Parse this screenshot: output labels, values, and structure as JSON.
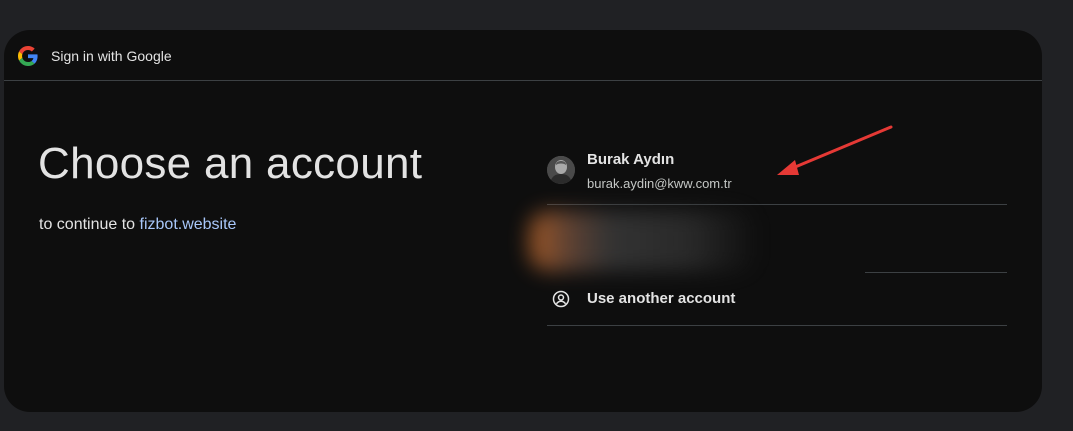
{
  "header": {
    "title": "Sign in with Google"
  },
  "main": {
    "title": "Choose an account",
    "subtitle_prefix": "to continue to ",
    "subtitle_link": "fizbot.website"
  },
  "accounts": [
    {
      "name": "Burak Aydın",
      "email": "burak.aydin@kww.com.tr",
      "icon": "user-avatar"
    }
  ],
  "use_another": {
    "label": "Use another account",
    "icon": "person-circle-icon"
  },
  "colors": {
    "accent_link": "#a8c7fa",
    "annotation_arrow": "#e53935"
  }
}
